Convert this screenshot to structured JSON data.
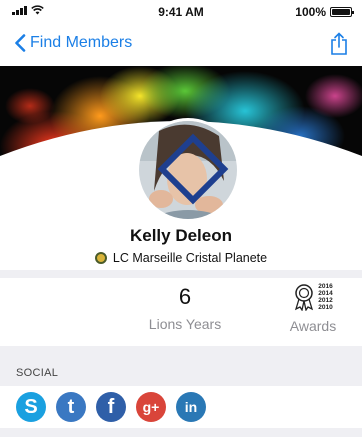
{
  "status_bar": {
    "time": "9:41 AM",
    "battery": "100%",
    "battery_level": 1.0
  },
  "nav": {
    "back_label": "Find Members",
    "back_icon": "chevron-left-icon",
    "share_icon": "share-icon"
  },
  "profile": {
    "name": "Kelly Deleon",
    "club": "LC Marseille Cristal Planete"
  },
  "stats": {
    "years_value": "6",
    "years_label": "Lions Years",
    "awards_label": "Awards",
    "award_years": [
      "2016",
      "2014",
      "2012",
      "2010"
    ]
  },
  "social": {
    "title": "SOCIAL",
    "networks": [
      {
        "name": "skype",
        "glyph": "S",
        "color": "#1aa0e0"
      },
      {
        "name": "twitter",
        "glyph": "t",
        "color": "#3a78c2"
      },
      {
        "name": "facebook",
        "glyph": "f",
        "color": "#2f5fa8"
      },
      {
        "name": "google-plus",
        "glyph": "g+",
        "color": "#d9453a"
      },
      {
        "name": "linkedin",
        "glyph": "in",
        "color": "#2a78b5"
      }
    ]
  },
  "colors": {
    "accent": "#1b7fe6",
    "band": "#efeff3",
    "muted": "#8e8e93"
  }
}
